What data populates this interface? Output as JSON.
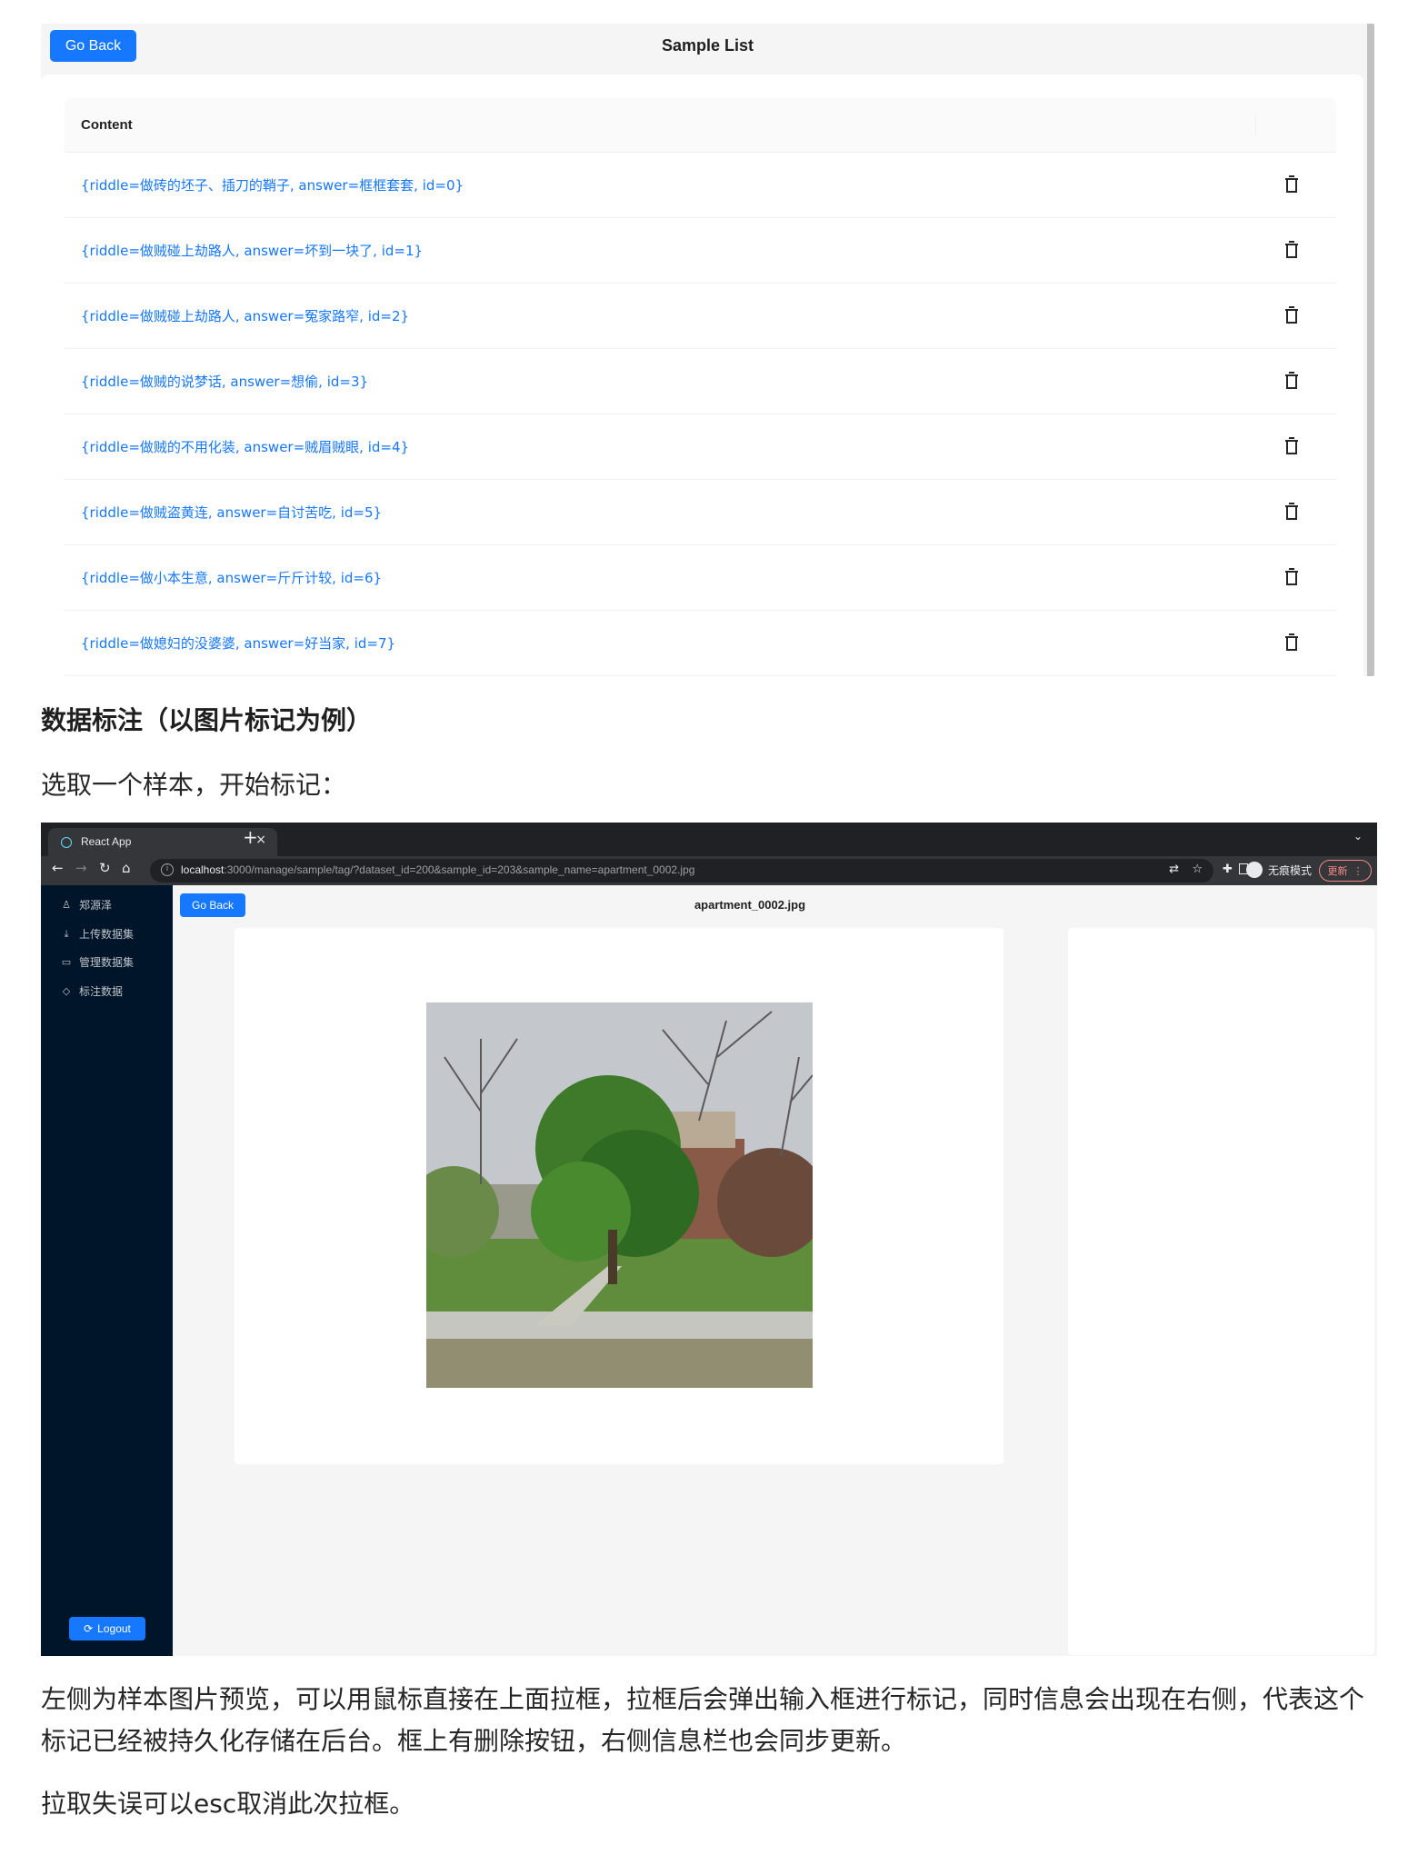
{
  "sample_list": {
    "go_back_label": "Go Back",
    "title": "Sample List",
    "table_header": "Content",
    "rows": [
      "{riddle=做砖的坯子、插刀的鞘子, answer=框框套套, id=0}",
      "{riddle=做贼碰上劫路人, answer=坏到一块了, id=1}",
      "{riddle=做贼碰上劫路人, answer=冤家路窄, id=2}",
      "{riddle=做贼的说梦话, answer=想偷, id=3}",
      "{riddle=做贼的不用化装, answer=贼眉贼眼, id=4}",
      "{riddle=做贼盗黄连, answer=自讨苦吃, id=5}",
      "{riddle=做小本生意, answer=斤斤计较, id=6}",
      "{riddle=做媳妇的没婆婆, answer=好当家, id=7}"
    ],
    "row_action_icon": "trash-icon"
  },
  "article": {
    "heading": "数据标注（以图片标记为例）",
    "intro": "选取一个样本，开始标记：",
    "paragraph1": "左侧为样本图片预览，可以用鼠标直接在上面拉框，拉框后会弹出输入框进行标记，同时信息会出现在右侧，代表这个标记已经被持久化存储在后台。框上有删除按钮，右侧信息栏也会同步更新。",
    "paragraph2": "拉取失误可以esc取消此次拉框。"
  },
  "browser": {
    "tab_title": "React App",
    "tab_close": "×",
    "new_tab": "+",
    "tab_dropdown": "⌄",
    "url_host": "localhost",
    "url_rest": ":3000/manage/sample/tag/?dataset_id=200&sample_id=203&sample_name=apartment_0002.jpg",
    "incognito_label": "无痕模式",
    "update_label": "更新",
    "sidebar": {
      "user": "郑源泽",
      "items": [
        "上传数据集",
        "管理数据集",
        "标注数据"
      ],
      "logout_label": "Logout"
    },
    "go_back_label": "Go Back",
    "page_title": "apartment_0002.jpg"
  }
}
